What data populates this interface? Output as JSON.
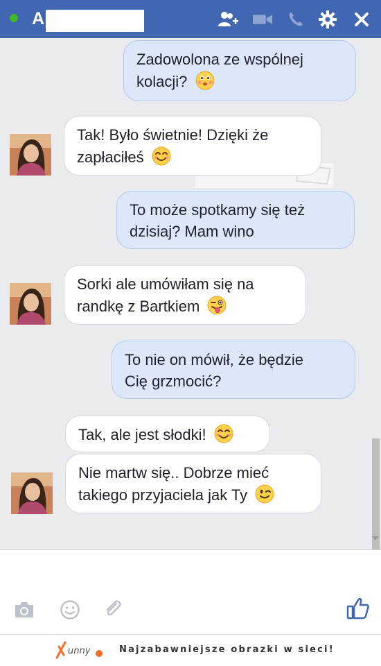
{
  "header": {
    "contact_initial": "A",
    "icons": [
      "add-friend-icon",
      "video-call-icon",
      "phone-icon",
      "gear-icon",
      "close-icon"
    ],
    "bg_color": "#4267b2",
    "online_color": "#42b72a"
  },
  "messages": [
    {
      "direction": "outgoing",
      "lines": [
        "Zadowolona ze wspólnej",
        "kolacji?"
      ],
      "emoji": "kiss-face"
    },
    {
      "direction": "incoming",
      "lines": [
        "Tak! Było świetnie! Dzięki że",
        "zapłaciłeś"
      ],
      "emoji": "smiling-face"
    },
    {
      "direction": "outgoing",
      "lines": [
        "To może spotkamy się też",
        "dzisiaj? Mam wino"
      ]
    },
    {
      "direction": "incoming",
      "lines": [
        "Sorki ale umówiłam się na",
        "randkę z Bartkiem"
      ],
      "emoji": "tongue-wink-face"
    },
    {
      "direction": "outgoing",
      "lines": [
        "To nie on mówił, że będzie",
        "Cię grzmocić?"
      ]
    },
    {
      "direction": "incoming",
      "lines": [
        "Tak, ale jest słodki!"
      ],
      "emoji": "smiling-face"
    },
    {
      "direction": "incoming",
      "lines": [
        "Nie martw się.. Dobrze mieć",
        "takiego przyjaciela jak Ty"
      ],
      "emoji": "wink-face"
    }
  ],
  "composer": {
    "icons": [
      "camera-icon",
      "emoji-icon",
      "attachment-icon",
      "like-icon"
    ],
    "like_color": "#4267b2"
  },
  "footer": {
    "logo_text": "Funny",
    "tagline": "Najzabawniejsze obrazki w sieci!"
  }
}
